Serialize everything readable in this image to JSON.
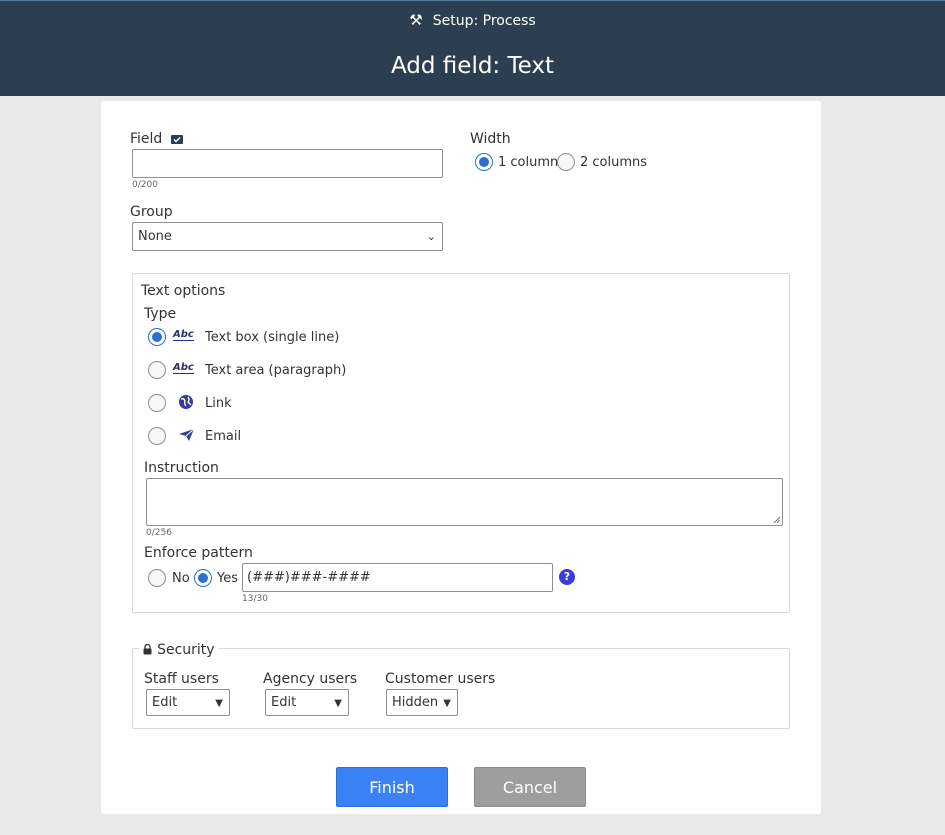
{
  "header": {
    "breadcrumb": "Setup: Process",
    "title": "Add field: Text"
  },
  "field": {
    "label": "Field",
    "value": "",
    "counter": "0/200"
  },
  "width": {
    "label": "Width",
    "options": [
      "1 column",
      "2 columns"
    ],
    "selected": "1 column"
  },
  "group": {
    "label": "Group",
    "selected": "None"
  },
  "text_options": {
    "title": "Text options",
    "type_label": "Type",
    "types": [
      {
        "label": "Text box (single line)",
        "icon": "abc-icon",
        "selected": true
      },
      {
        "label": "Text area (paragraph)",
        "icon": "abc-icon",
        "selected": false
      },
      {
        "label": "Link",
        "icon": "globe-icon",
        "selected": false
      },
      {
        "label": "Email",
        "icon": "paper-plane-icon",
        "selected": false
      }
    ],
    "abc_glyph": "Abc",
    "instruction_label": "Instruction",
    "instruction_value": "",
    "instruction_counter": "0/256",
    "enforce_label": "Enforce pattern",
    "enforce_no": "No",
    "enforce_yes": "Yes",
    "enforce_selected": "Yes",
    "pattern_value": "(###)###-####",
    "pattern_counter": "13/30",
    "help_glyph": "?"
  },
  "security": {
    "title": "Security",
    "columns": [
      {
        "label": "Staff users",
        "selected": "Edit"
      },
      {
        "label": "Agency users",
        "selected": "Edit"
      },
      {
        "label": "Customer users",
        "selected": "Hidden"
      }
    ]
  },
  "buttons": {
    "finish": "Finish",
    "cancel": "Cancel"
  },
  "colors": {
    "header_bg": "#2d3e52",
    "accent": "#2a6fd3",
    "finish_bg": "#3b82f6",
    "cancel_bg": "#9e9e9e"
  }
}
